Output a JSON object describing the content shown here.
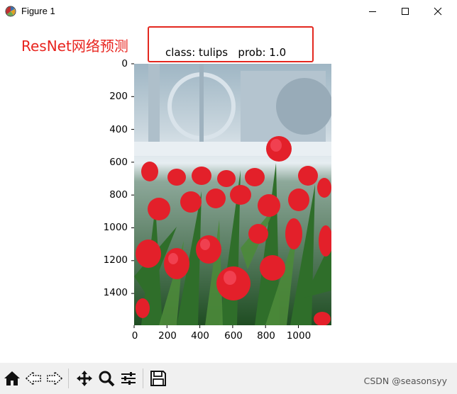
{
  "window": {
    "title": "Figure 1",
    "icons": [
      "matplotlib-logo-icon",
      "minimize-icon",
      "maximize-icon",
      "close-icon"
    ]
  },
  "annotation": {
    "text": "ResNet网络预测",
    "color": "#e8241e"
  },
  "plot": {
    "title": "class: tulips   prob: 1.0",
    "y_ticks": [
      "0",
      "200",
      "400",
      "600",
      "800",
      "1000",
      "1200",
      "1400"
    ],
    "x_ticks": [
      "0",
      "200",
      "400",
      "600",
      "800",
      "1000"
    ],
    "image_subject": "red tulips photo"
  },
  "toolbar": {
    "buttons": [
      "home-icon",
      "back-icon",
      "forward-icon",
      "pan-icon",
      "zoom-icon",
      "configure-subplots-icon",
      "save-icon"
    ]
  },
  "watermark": {
    "text": "CSDN @seasonsyy"
  }
}
